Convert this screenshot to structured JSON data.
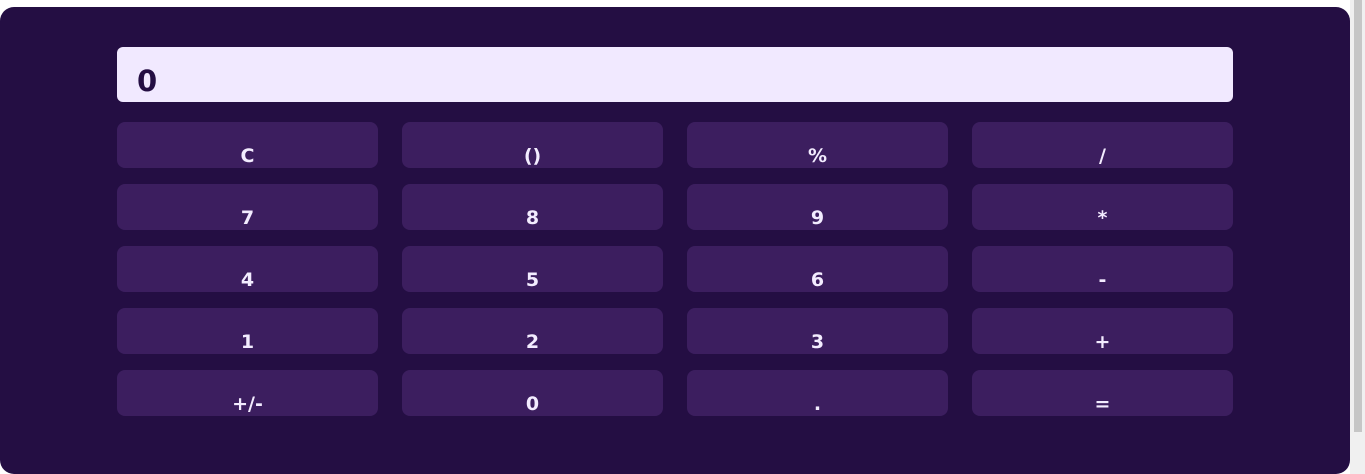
{
  "display": {
    "value": "0"
  },
  "keys": [
    {
      "label": "C",
      "name": "clear-button"
    },
    {
      "label": "()",
      "name": "parentheses-button"
    },
    {
      "label": "%",
      "name": "percent-button"
    },
    {
      "label": "/",
      "name": "divide-button"
    },
    {
      "label": "7",
      "name": "digit-7-button"
    },
    {
      "label": "8",
      "name": "digit-8-button"
    },
    {
      "label": "9",
      "name": "digit-9-button"
    },
    {
      "label": "*",
      "name": "multiply-button"
    },
    {
      "label": "4",
      "name": "digit-4-button"
    },
    {
      "label": "5",
      "name": "digit-5-button"
    },
    {
      "label": "6",
      "name": "digit-6-button"
    },
    {
      "label": "-",
      "name": "subtract-button"
    },
    {
      "label": "1",
      "name": "digit-1-button"
    },
    {
      "label": "2",
      "name": "digit-2-button"
    },
    {
      "label": "3",
      "name": "digit-3-button"
    },
    {
      "label": "+",
      "name": "add-button"
    },
    {
      "label": "+/-",
      "name": "toggle-sign-button"
    },
    {
      "label": "0",
      "name": "digit-0-button"
    },
    {
      "label": ".",
      "name": "decimal-button"
    },
    {
      "label": "=",
      "name": "equals-button"
    }
  ],
  "colors": {
    "background": "#240e43",
    "display_bg": "#f1e9ff",
    "key_bg": "#3c1e5f",
    "key_text": "#f3ecff"
  }
}
